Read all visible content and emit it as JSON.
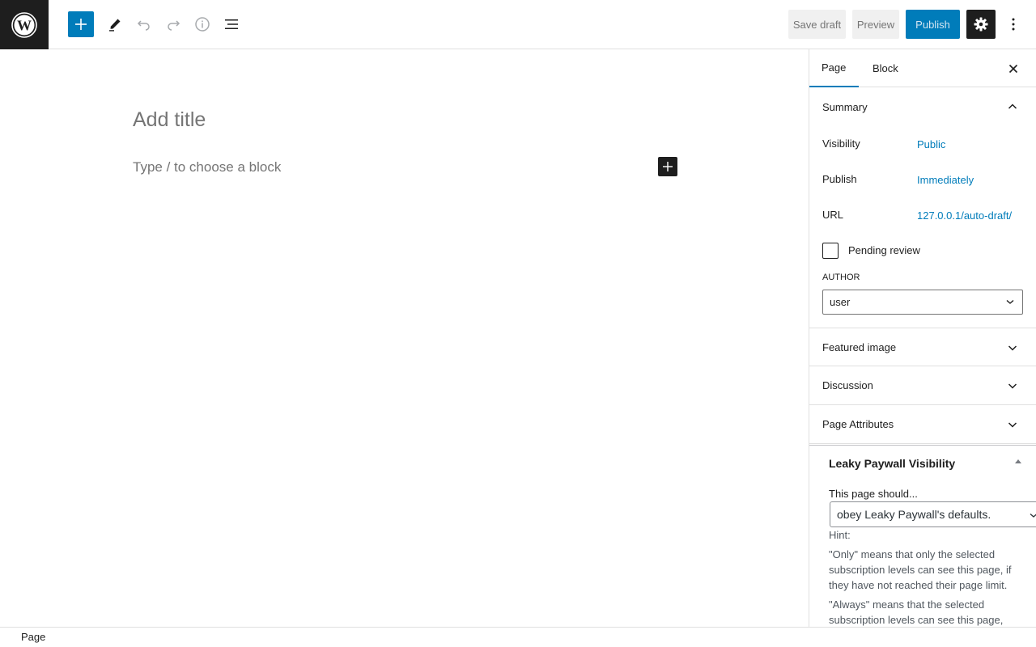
{
  "toolbar": {
    "save_draft": "Save draft",
    "preview": "Preview",
    "publish": "Publish",
    "icons": [
      "wordpress-logo",
      "plus",
      "pencil",
      "undo",
      "redo",
      "info",
      "list-view",
      "gear",
      "more-vertical"
    ]
  },
  "editor": {
    "title_placeholder": "Add title",
    "block_placeholder": "Type / to choose a block"
  },
  "sidebar": {
    "tabs": [
      {
        "label": "Page",
        "active": true
      },
      {
        "label": "Block",
        "active": false
      }
    ],
    "summary": {
      "title": "Summary",
      "visibility_label": "Visibility",
      "visibility_value": "Public",
      "publish_label": "Publish",
      "publish_value": "Immediately",
      "url_label": "URL",
      "url_value": "127.0.0.1/auto-draft/",
      "pending_review": "Pending review",
      "pending_checked": false,
      "author_label": "AUTHOR",
      "author_value": "user"
    },
    "panels": [
      {
        "title": "Featured image"
      },
      {
        "title": "Discussion"
      },
      {
        "title": "Page Attributes"
      }
    ],
    "leaky": {
      "title": "Leaky Paywall Visibility",
      "should_label": "This page should...",
      "select_value": "obey Leaky Paywall's defaults.",
      "hint_label": "Hint:",
      "only_text": "\"Only\" means that only the selected subscription levels can see this page, if they have not reached their page limit.",
      "always_text": "\"Always\" means that the selected subscription levels can see this page,"
    }
  },
  "footer": {
    "breadcrumb": "Page"
  },
  "colors": {
    "accent": "#007cba",
    "dark": "#1e1e1e",
    "border": "#e0e0e0"
  }
}
